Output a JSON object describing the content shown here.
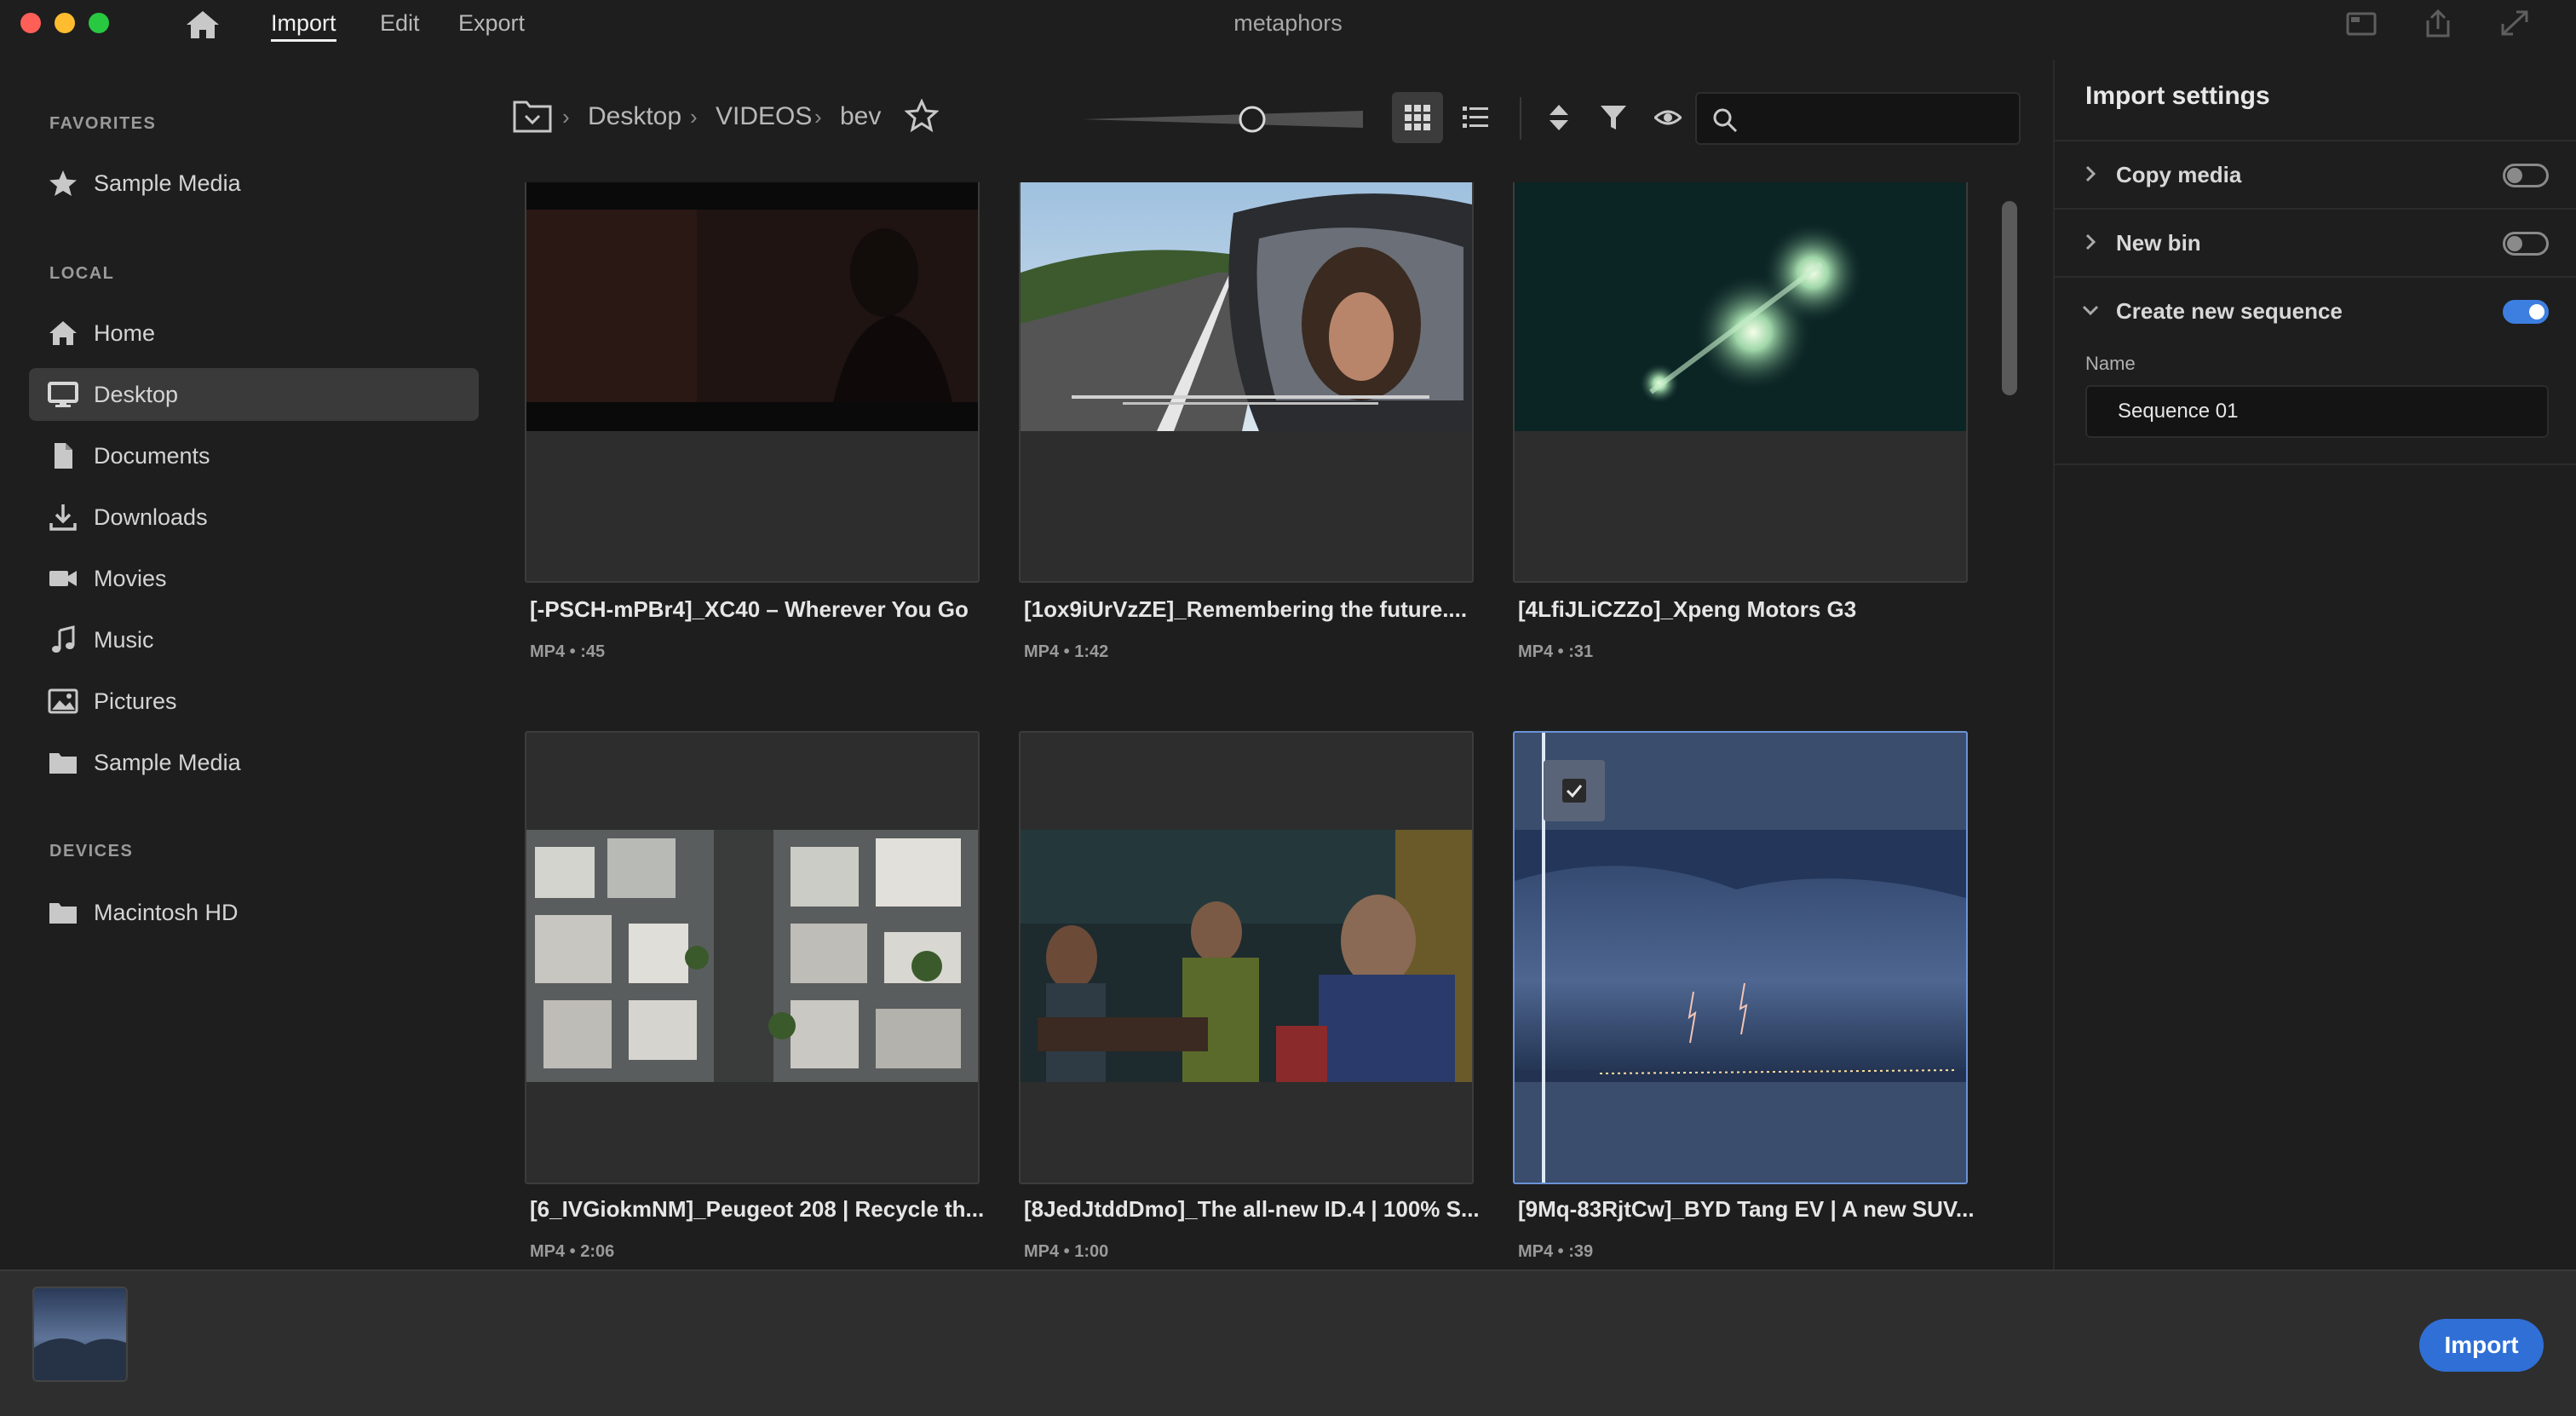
{
  "app": {
    "title": "metaphors",
    "menu": {
      "import": "Import",
      "edit": "Edit",
      "export": "Export"
    }
  },
  "sidebar": {
    "favorites_title": "FAVORITES",
    "favorites": [
      {
        "label": "Sample Media",
        "icon": "star-icon"
      }
    ],
    "local_title": "LOCAL",
    "local": [
      {
        "label": "Home",
        "icon": "home-icon"
      },
      {
        "label": "Desktop",
        "icon": "desktop-icon",
        "selected": true
      },
      {
        "label": "Documents",
        "icon": "document-icon"
      },
      {
        "label": "Downloads",
        "icon": "download-icon"
      },
      {
        "label": "Movies",
        "icon": "video-camera-icon"
      },
      {
        "label": "Music",
        "icon": "music-note-icon"
      },
      {
        "label": "Pictures",
        "icon": "picture-icon"
      },
      {
        "label": "Sample Media",
        "icon": "folder-icon"
      }
    ],
    "devices_title": "DEVICES",
    "devices": [
      {
        "label": "Macintosh HD",
        "icon": "folder-icon"
      }
    ]
  },
  "breadcrumb": {
    "items": [
      "Desktop",
      "VIDEOS",
      "bev"
    ]
  },
  "search": {
    "placeholder": "",
    "value": ""
  },
  "media": [
    {
      "title": "[-PSCH-mPBr4]_XC40 – Wherever You Go",
      "meta": "MP4 • :45"
    },
    {
      "title": "[1ox9iUrVzZE]_Remembering the future....",
      "meta": "MP4 • 1:42"
    },
    {
      "title": "[4LfiJLiCZZo]_Xpeng Motors G3",
      "meta": "MP4 • :31"
    },
    {
      "title": "[6_IVGiokmNM]_Peugeot 208 | Recycle th...",
      "meta": "MP4 • 2:06"
    },
    {
      "title": "[8JedJtddDmo]_The all-new ID.4 | 100% S...",
      "meta": "MP4 • 1:00"
    },
    {
      "title": "[9Mq-83RjtCw]_BYD Tang EV | A new SUV...",
      "meta": "MP4 • :39",
      "selected": true
    }
  ],
  "import_settings": {
    "title": "Import settings",
    "copy_media": {
      "label": "Copy media",
      "on": false
    },
    "new_bin": {
      "label": "New bin",
      "on": false
    },
    "create_sequence": {
      "label": "Create new sequence",
      "on": true
    },
    "name_label": "Name",
    "name_value": "Sequence 01"
  },
  "footer": {
    "import_button": "Import"
  },
  "colors": {
    "accent": "#2f6fd6",
    "selection": "#3a4d6c",
    "background": "#1e1e1e"
  }
}
